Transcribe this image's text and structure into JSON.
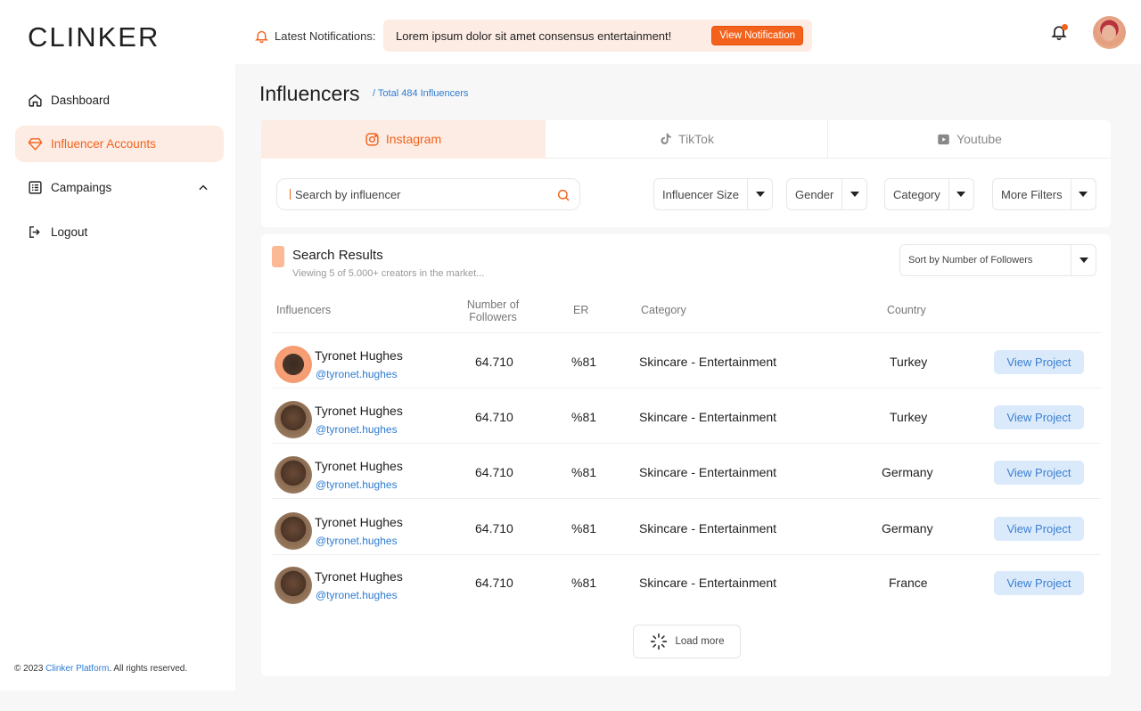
{
  "header": {
    "logo": "CLINKER",
    "notifications_label": "Latest Notifications:",
    "notification_text": "Lorem ipsum dolor sit amet consensus entertainment!",
    "view_notification_label": "View Notification",
    "accent_color": "#f3621c"
  },
  "sidebar": {
    "items": [
      {
        "label": "Dashboard",
        "icon": "home-icon"
      },
      {
        "label": "Influencer Accounts",
        "icon": "diamond-icon"
      },
      {
        "label": "Campaings",
        "icon": "list-icon"
      },
      {
        "label": "Logout",
        "icon": "logout-icon"
      }
    ],
    "footer_prefix": "© 2023 ",
    "footer_brand": "Clinker Platform",
    "footer_suffix": ". All rights reserved."
  },
  "main": {
    "title": "Influencers",
    "subtitle": "/ Total 484 Influencers",
    "tabs": [
      {
        "label": "Instagram",
        "icon": "instagram-icon"
      },
      {
        "label": "TikTok",
        "icon": "tiktok-icon"
      },
      {
        "label": "Youtube",
        "icon": "youtube-icon"
      }
    ],
    "search_placeholder": "Search by influencer",
    "filters": [
      "Influencer Size",
      "Gender",
      "Category",
      "More Filters"
    ],
    "results": {
      "title": "Search Results",
      "subtitle": "Viewing 5 of 5.000+ creators in the market...",
      "sort_label": "Sort by Number of Followers",
      "columns": [
        "Influencers",
        "Number of Followers",
        "ER",
        "Category",
        "Country"
      ],
      "rows": [
        {
          "name": "Tyronet Hughes",
          "handle": "@tyronet.hughes",
          "followers": "64.710",
          "er": "%81",
          "category": "Skincare - Entertainment",
          "country": "Turkey",
          "action": "View Project"
        },
        {
          "name": "Tyronet Hughes",
          "handle": "@tyronet.hughes",
          "followers": "64.710",
          "er": "%81",
          "category": "Skincare - Entertainment",
          "country": "Turkey",
          "action": "View Project"
        },
        {
          "name": "Tyronet Hughes",
          "handle": "@tyronet.hughes",
          "followers": "64.710",
          "er": "%81",
          "category": "Skincare - Entertainment",
          "country": "Germany",
          "action": "View Project"
        },
        {
          "name": "Tyronet Hughes",
          "handle": "@tyronet.hughes",
          "followers": "64.710",
          "er": "%81",
          "category": "Skincare - Entertainment",
          "country": "Germany",
          "action": "View Project"
        },
        {
          "name": "Tyronet Hughes",
          "handle": "@tyronet.hughes",
          "followers": "64.710",
          "er": "%81",
          "category": "Skincare - Entertainment",
          "country": "France",
          "action": "View Project"
        }
      ],
      "load_more": "Load more"
    }
  }
}
